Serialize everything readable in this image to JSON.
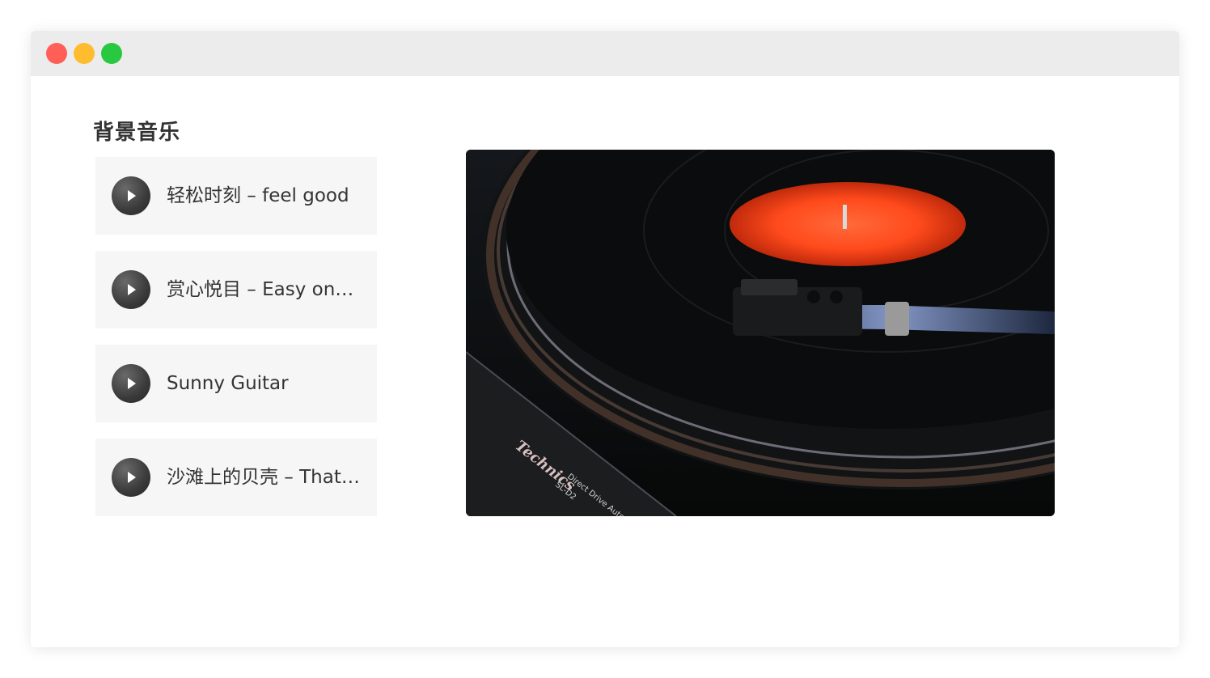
{
  "window": {
    "controls": [
      "close",
      "minimize",
      "maximize"
    ],
    "colors": {
      "close": "#ff5f57",
      "minimize": "#febc2e",
      "maximize": "#28c840"
    }
  },
  "section": {
    "title": "背景音乐"
  },
  "tracks": [
    {
      "label": "轻松时刻 – feel good",
      "icon": "play-icon"
    },
    {
      "label": "赏心悦目 – Easy on…",
      "icon": "play-icon"
    },
    {
      "label": "Sunny Guitar",
      "icon": "play-icon"
    },
    {
      "label": "沙滩上的贝壳 – That…",
      "icon": "play-icon"
    }
  ],
  "image": {
    "subject": "turntable-photo",
    "brand": "Technics",
    "text_lines": [
      "Direct Drive Automatic",
      "SL-D2"
    ]
  }
}
